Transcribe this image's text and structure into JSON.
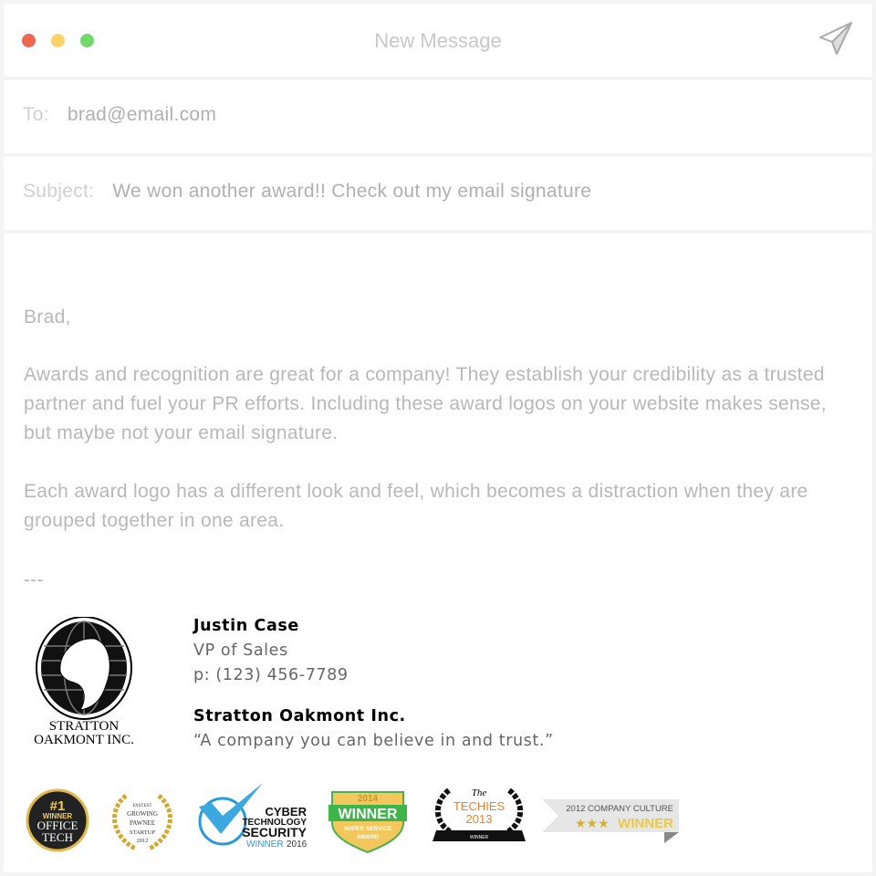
{
  "window": {
    "title": "New Message",
    "traffic_lights": [
      "#ec6650",
      "#fdd36a",
      "#72d86e"
    ],
    "send_icon": "paper-plane-icon"
  },
  "to": {
    "label": "To:",
    "value": "brad@email.com"
  },
  "subject": {
    "label": "Subject:",
    "value": "We won another award!! Check out my email signature"
  },
  "body": {
    "greeting": "Brad,",
    "paragraphs": [
      "Awards and recognition are great for a company! They establish your credibility as a trusted partner and fuel your PR efforts. Including these award logos on your website makes sense, but maybe not your email signature.",
      "Each award logo has a different look and feel, which becomes a distraction when they are grouped together in one area."
    ],
    "separator": "---"
  },
  "signature": {
    "logo_text": [
      "Stratton",
      "Oakmont Inc."
    ],
    "name": "Justin Case",
    "title": "VP of Sales",
    "phone": "p: (123) 456-7789",
    "company": "Stratton Oakmont Inc.",
    "tagline": "“A company you can believe in and trust.”"
  },
  "badges": [
    {
      "lines": [
        "#1",
        "WINNER",
        "OFFICE",
        "TECH"
      ]
    },
    {
      "lines": [
        "FASTEST",
        "GROWING",
        "PAWNEE",
        "STARTUP",
        "2012"
      ]
    },
    {
      "lines": [
        "CYBER",
        "TECHNOLOGY",
        "SECURITY",
        "WINNER",
        "2016"
      ]
    },
    {
      "lines": [
        "2014",
        "WINNER",
        "SUPER SERVICE",
        "AWARD"
      ]
    },
    {
      "lines": [
        "The",
        "TECHIES",
        "2013",
        "WINNER"
      ]
    },
    {
      "lines": [
        "2012 COMPANY CULTURE",
        "★★★",
        "WINNER"
      ]
    }
  ]
}
